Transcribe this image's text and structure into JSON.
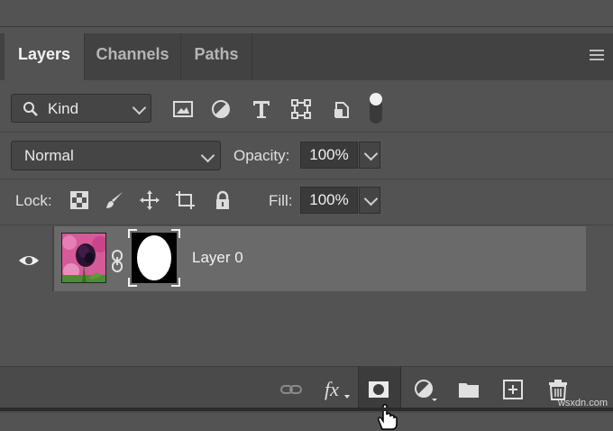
{
  "tabs": [
    {
      "label": "Layers",
      "active": true
    },
    {
      "label": "Channels",
      "active": false
    },
    {
      "label": "Paths",
      "active": false
    }
  ],
  "filter": {
    "kind_label": "Kind",
    "icons": [
      "image-filter-icon",
      "adjustment-filter-icon",
      "type-filter-icon",
      "shape-filter-icon",
      "smart-object-filter-icon"
    ]
  },
  "blend": {
    "mode": "Normal",
    "opacity_label": "Opacity:",
    "opacity_value": "100%"
  },
  "lock": {
    "label": "Lock:",
    "fill_label": "Fill:",
    "fill_value": "100%",
    "icons": [
      "lock-transparent-icon",
      "lock-image-icon",
      "lock-position-icon",
      "lock-artboard-icon",
      "lock-all-icon"
    ]
  },
  "layers": [
    {
      "name": "Layer 0",
      "visible": true,
      "has_mask": true
    }
  ],
  "bottom_bar": {
    "icons": [
      "link-layers-icon",
      "fx-icon",
      "add-mask-icon",
      "adjustment-layer-icon",
      "new-group-icon",
      "new-layer-icon",
      "delete-layer-icon"
    ],
    "fx_label": "fx"
  },
  "watermark": "wsxdn.com",
  "colors": {
    "panel": "#535353",
    "tab_bar": "#424242",
    "selected_layer": "#6a6a6a"
  }
}
